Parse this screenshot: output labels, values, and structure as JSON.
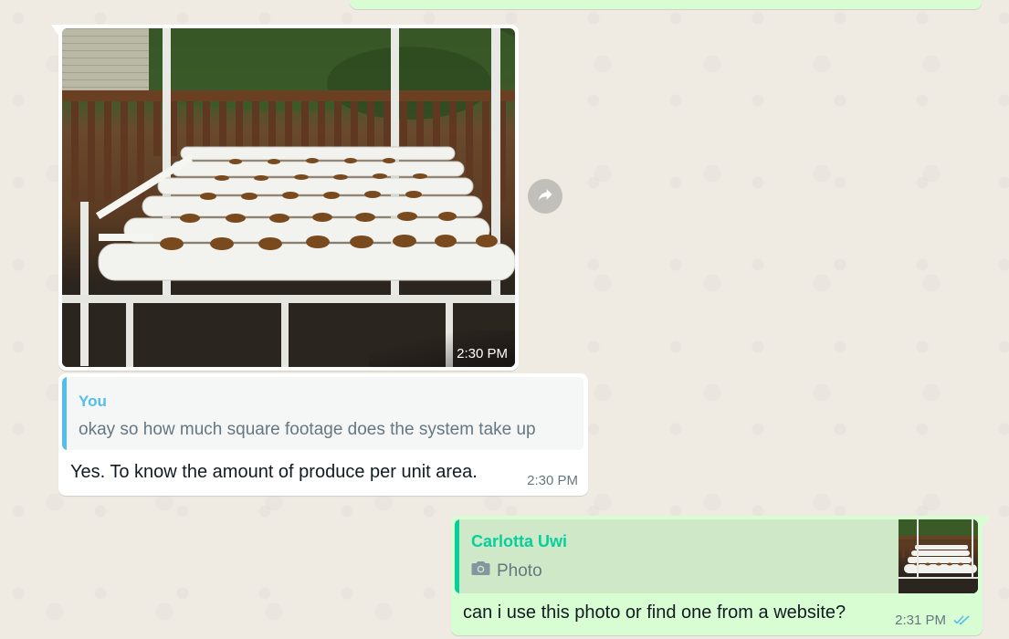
{
  "messages": {
    "image_message": {
      "time": "2:30 PM"
    },
    "text_message": {
      "quoted": {
        "author": "You",
        "text": "okay so how much square footage does the system take up"
      },
      "text": "Yes. To know the amount of produce per unit area.",
      "time": "2:30 PM"
    },
    "reply_message": {
      "quoted": {
        "author": "Carlotta Uwi",
        "type_label": "Photo"
      },
      "text": "can i use this photo or find one from a website?",
      "time": "2:31 PM",
      "status": "read"
    }
  },
  "icons": {
    "forward": "forward-icon",
    "camera": "camera-icon",
    "read_receipt": "double-check-icon"
  },
  "colors": {
    "chat_background": "#efeae2",
    "incoming_bubble": "#ffffff",
    "outgoing_bubble": "#d9fdd3",
    "quote_you": "#53bdeb",
    "quote_contact": "#06cf9c",
    "read_ticks": "#53bdeb"
  }
}
